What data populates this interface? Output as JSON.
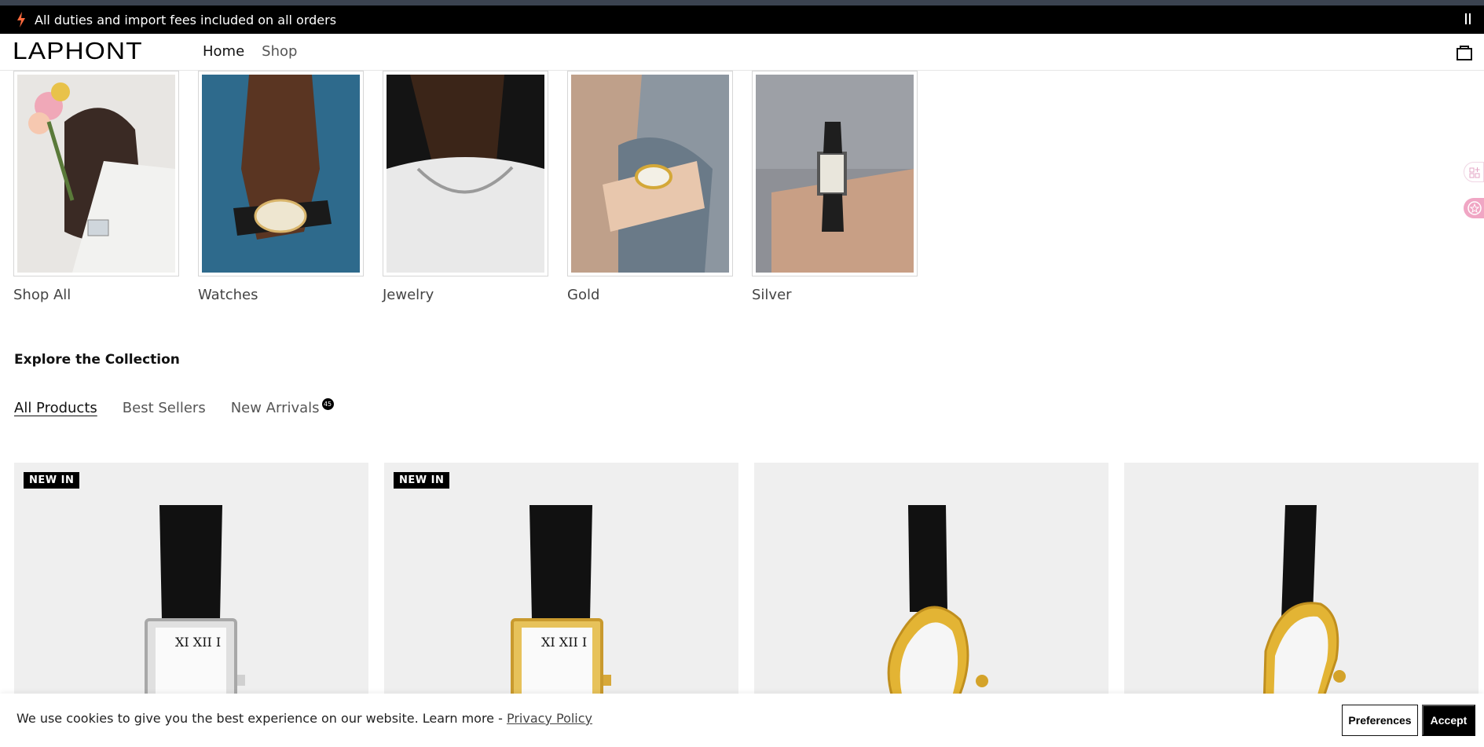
{
  "announcement": {
    "text": "All duties and import fees included on all orders",
    "icon": "lightning-icon"
  },
  "header": {
    "logo": "LAPHONT",
    "nav": [
      {
        "label": "Home"
      },
      {
        "label": "Shop"
      }
    ],
    "cart_icon": "bag-icon"
  },
  "categories": [
    {
      "label": "Shop All"
    },
    {
      "label": "Watches"
    },
    {
      "label": "Jewelry"
    },
    {
      "label": "Gold"
    },
    {
      "label": "Silver"
    }
  ],
  "collection": {
    "title": "Explore the Collection",
    "tabs": [
      {
        "label": "All Products",
        "active": true
      },
      {
        "label": "Best Sellers"
      },
      {
        "label": "New Arrivals",
        "count": "45"
      }
    ]
  },
  "products": [
    {
      "badge": "NEW IN",
      "case": "silver",
      "shape": "tank"
    },
    {
      "badge": "NEW IN",
      "case": "gold",
      "shape": "tank"
    },
    {
      "badge": "",
      "case": "gold",
      "shape": "melted"
    },
    {
      "badge": "",
      "case": "gold",
      "shape": "melted"
    }
  ],
  "cookie": {
    "text": "We use cookies to give you the best experience on our website. Learn more - ",
    "link": "Privacy Policy",
    "preferences": "Preferences",
    "accept": "Accept"
  },
  "colors": {
    "bar": "#000000",
    "accent": "#ff6a3d",
    "product_bg": "#efefef"
  }
}
